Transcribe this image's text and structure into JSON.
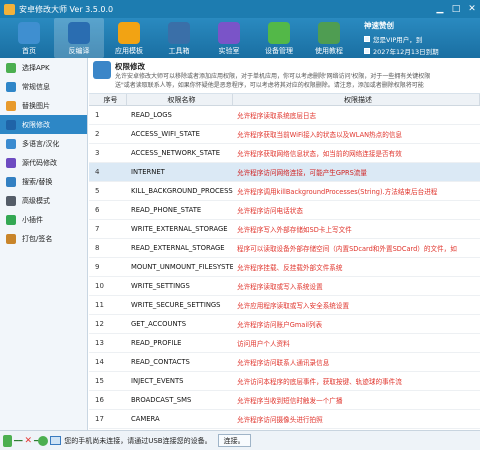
{
  "window": {
    "title": "安卓修改大师 Ver 3.5.0.0",
    "controls": [
      "minimize-icon",
      "maximize-icon",
      "close-icon"
    ]
  },
  "toolbar": {
    "items": [
      {
        "label": "首页",
        "icon": "home-icon",
        "color": "#3f8fd0",
        "active": false
      },
      {
        "label": "反编译",
        "icon": "decompile-icon",
        "color": "#2a6db1",
        "active": true
      },
      {
        "label": "应用模板",
        "icon": "star-icon",
        "color": "#f2a313",
        "active": false
      },
      {
        "label": "工具箱",
        "icon": "toolbox-icon",
        "color": "#3a6fa8",
        "active": false
      },
      {
        "label": "实验室",
        "icon": "flask-icon",
        "color": "#7a54c8",
        "active": false
      },
      {
        "label": "设备管理",
        "icon": "device-check-icon",
        "color": "#53b848",
        "active": false
      },
      {
        "label": "使用教程",
        "icon": "chalkboard-icon",
        "color": "#4f9d52",
        "active": false
      }
    ]
  },
  "vip": {
    "title": "神速赞创",
    "line1": "您是VIP用户，到",
    "line2": "2027年12月13日到期"
  },
  "sidebar": {
    "items": [
      {
        "label": "选择APK",
        "icon": "apk-icon",
        "color": "#4caf50",
        "active": false
      },
      {
        "label": "常规信息",
        "icon": "info-icon",
        "color": "#2f86c8",
        "active": false
      },
      {
        "label": "替换图片",
        "icon": "image-icon",
        "color": "#e89a2c",
        "active": false
      },
      {
        "label": "权限修改",
        "icon": "permission-icon",
        "color": "#1f64a8",
        "active": true
      },
      {
        "label": "多语言/汉化",
        "icon": "language-icon",
        "color": "#3b8bd0",
        "active": false
      },
      {
        "label": "源代码修改",
        "icon": "source-code-icon",
        "color": "#6d4bc1",
        "active": false
      },
      {
        "label": "搜索/替换",
        "icon": "search-icon",
        "color": "#3380c2",
        "active": false
      },
      {
        "label": "高级模式",
        "icon": "advanced-icon",
        "color": "#555d68",
        "active": false
      },
      {
        "label": "小插件",
        "icon": "plugin-icon",
        "color": "#34a853",
        "active": false
      },
      {
        "label": "打包/签名",
        "icon": "package-icon",
        "color": "#c9852a",
        "active": false
      }
    ]
  },
  "info": {
    "icon": "permission-info-icon",
    "title": "权限修改",
    "line1": "允许安卓修改大师可以移除或者添加应用权限，对于单机应用，你可以考虑删除'网络访问'权限，对于一些拥有关键权限",
    "line2": "送\"或者读取联系人等，如果你怀疑他是恶意程序，可以考虑将其对应的权限删除。请注意，添加或者删除权限将可能"
  },
  "table": {
    "headers": [
      "序号",
      "权限名称",
      "权限描述"
    ],
    "rows": [
      {
        "num": "1",
        "name": "READ_LOGS",
        "desc": "允许程序读取系统底层日志",
        "selected": false
      },
      {
        "num": "2",
        "name": "ACCESS_WIFI_STATE",
        "desc": "允许程序获取当前WiFi接入的状态以及WLAN热点的信息",
        "selected": false
      },
      {
        "num": "3",
        "name": "ACCESS_NETWORK_STATE",
        "desc": "允许程序获取网络信息状态，如当前的网络连接是否有效",
        "selected": false
      },
      {
        "num": "4",
        "name": "INTERNET",
        "desc": "允许程序访问网络连接，可能产生GPRS流量",
        "selected": true
      },
      {
        "num": "5",
        "name": "KILL_BACKGROUND_PROCESSES",
        "desc": "允许程序调用killBackgroundProcesses(String).方法结束后台进程",
        "selected": false
      },
      {
        "num": "6",
        "name": "READ_PHONE_STATE",
        "desc": "允许程序访问电话状态",
        "selected": false
      },
      {
        "num": "7",
        "name": "WRITE_EXTERNAL_STORAGE",
        "desc": "允许程序写入外部存储如SD卡上写文件",
        "selected": false
      },
      {
        "num": "8",
        "name": "READ_EXTERNAL_STORAGE",
        "desc": "程序可以读取设备外部存储空间（内置SDcard和外置SDCard）的文件，如",
        "selected": false
      },
      {
        "num": "9",
        "name": "MOUNT_UNMOUNT_FILESYSTEMS",
        "desc": "允许程序挂载、反挂载外部文件系统",
        "selected": false
      },
      {
        "num": "10",
        "name": "WRITE_SETTINGS",
        "desc": "允许程序读取或写入系统设置",
        "selected": false
      },
      {
        "num": "11",
        "name": "WRITE_SECURE_SETTINGS",
        "desc": "允许应用程序读取或写入安全系统设置",
        "selected": false
      },
      {
        "num": "12",
        "name": "GET_ACCOUNTS",
        "desc": "允许程序访问账户Gmail列表",
        "selected": false
      },
      {
        "num": "13",
        "name": "READ_PROFILE",
        "desc": "访问用户个人资料",
        "selected": false
      },
      {
        "num": "14",
        "name": "READ_CONTACTS",
        "desc": "允许程序访问联系人通讯录信息",
        "selected": false
      },
      {
        "num": "15",
        "name": "INJECT_EVENTS",
        "desc": "允许访问本程序的底层事件，获取按键、轨迹球的事件流",
        "selected": false
      },
      {
        "num": "16",
        "name": "BROADCAST_SMS",
        "desc": "允许程序当收到短信时触发一个广播",
        "selected": false
      },
      {
        "num": "17",
        "name": "CAMERA",
        "desc": "允许程序访问摄像头进行拍照",
        "selected": false
      }
    ]
  },
  "status": {
    "text": "您的手机尚未连接，请通过USB连接您的设备。",
    "connect_label": "连接。"
  }
}
